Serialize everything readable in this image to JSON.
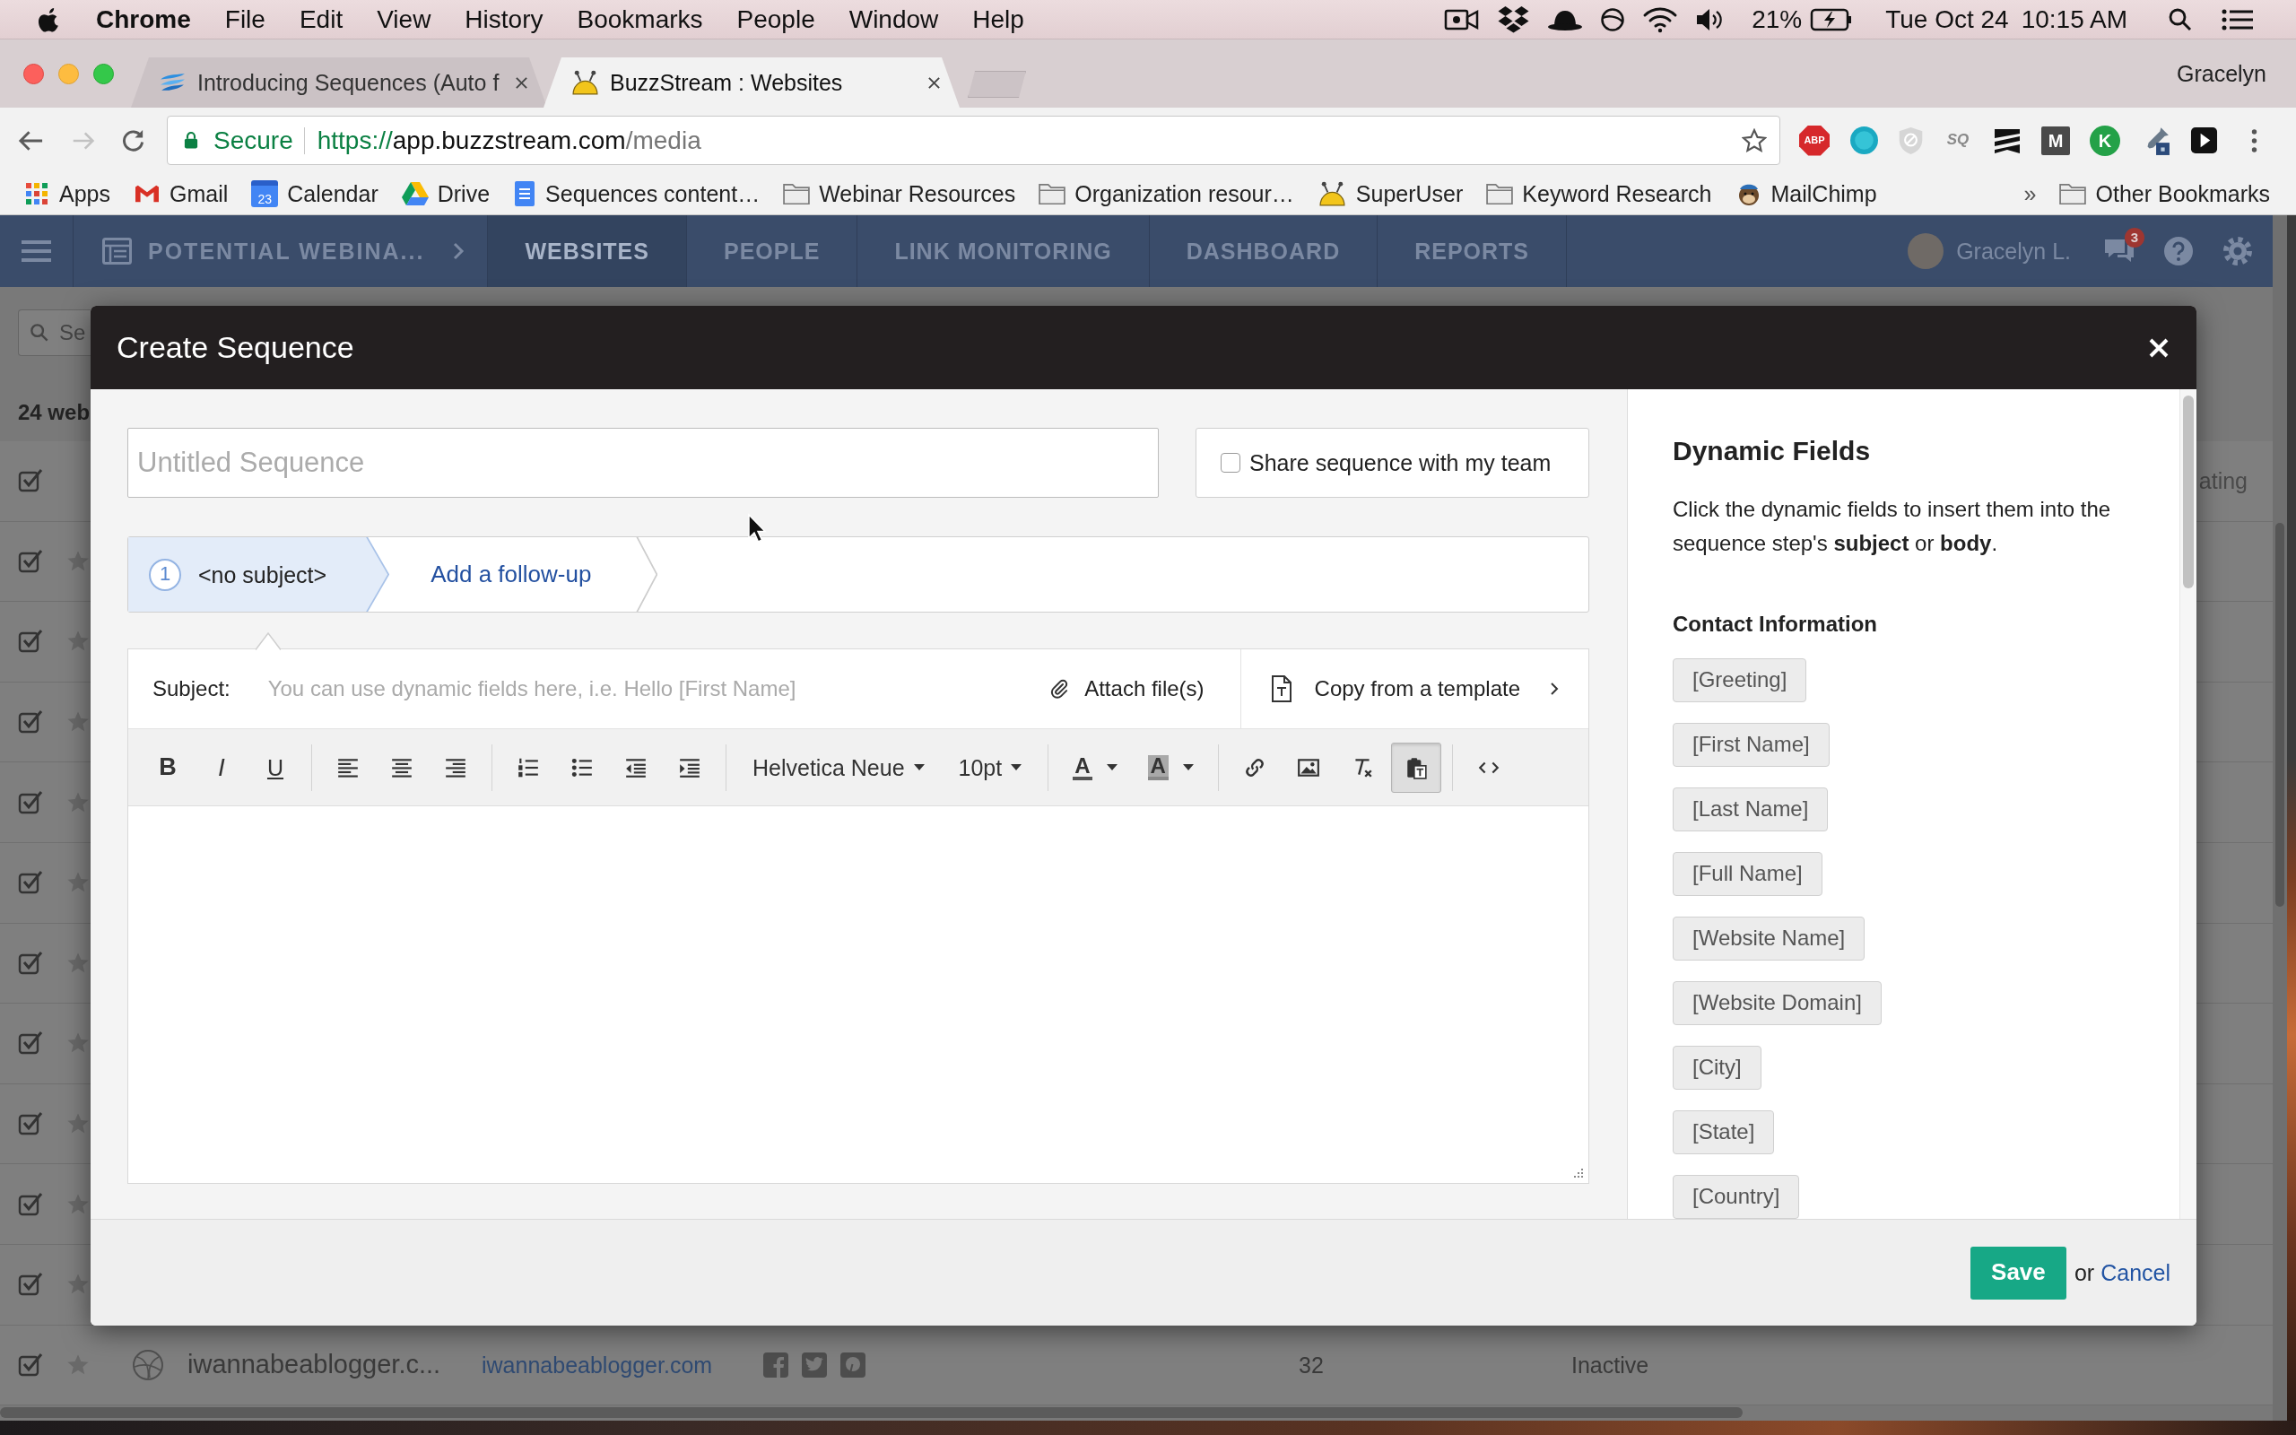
{
  "menu_bar": {
    "app": "Chrome",
    "menus": [
      "File",
      "Edit",
      "View",
      "History",
      "Bookmarks",
      "People",
      "Window",
      "Help"
    ],
    "battery": "21%",
    "date": "Tue Oct 24",
    "time": "10:15 AM"
  },
  "browser": {
    "tabs": [
      {
        "title": "Introducing Sequences (Auto f",
        "selected": false
      },
      {
        "title": "BuzzStream : Websites",
        "selected": true
      }
    ],
    "profile": "Gracelyn",
    "forward_disabled": true,
    "address": {
      "security": "Secure",
      "scheme": "https://",
      "host": "app.buzzstream.com",
      "path": "/media"
    },
    "extensions": [
      {
        "kind": "octagon",
        "text": "ABP"
      },
      {
        "kind": "disc"
      },
      {
        "kind": "shield"
      },
      {
        "kind": "burst",
        "text": "SQ"
      },
      {
        "kind": "stripes"
      },
      {
        "kind": "tile",
        "text": "M"
      },
      {
        "kind": "round",
        "text": "K"
      },
      {
        "kind": "dropper"
      },
      {
        "kind": "play"
      }
    ],
    "bookmarks": [
      {
        "kind": "apps",
        "label": "Apps"
      },
      {
        "kind": "mail",
        "label": "Gmail"
      },
      {
        "kind": "calendar",
        "label": "Calendar",
        "badge": "23"
      },
      {
        "kind": "drive",
        "label": "Drive"
      },
      {
        "kind": "doc",
        "label": "Sequences content…"
      },
      {
        "kind": "folder",
        "label": "Webinar Resources"
      },
      {
        "kind": "folder",
        "label": "Organization resour…"
      },
      {
        "kind": "dome",
        "label": "SuperUser"
      },
      {
        "kind": "folder",
        "label": "Keyword Research"
      },
      {
        "kind": "monkey",
        "label": "MailChimp"
      }
    ],
    "overflow": "»",
    "other_bookmarks": "Other Bookmarks"
  },
  "app": {
    "nav": {
      "project": "POTENTIAL WEBINA...",
      "tabs": [
        {
          "label": "WEBSITES",
          "selected": true
        },
        {
          "label": "PEOPLE",
          "selected": false
        },
        {
          "label": "LINK MONITORING",
          "selected": false
        },
        {
          "label": "DASHBOARD",
          "selected": false
        },
        {
          "label": "REPORTS",
          "selected": false
        }
      ],
      "user": "Gracelyn L.",
      "notifications": "3"
    },
    "search_placeholder": "Se",
    "count": "24 web",
    "rows": [
      {
        "kind": "header",
        "checked": true,
        "column": "ating"
      },
      {
        "kind": "item",
        "checked": true
      },
      {
        "kind": "item",
        "checked": true
      },
      {
        "kind": "item",
        "checked": true
      },
      {
        "kind": "item",
        "checked": true
      },
      {
        "kind": "item",
        "checked": true
      },
      {
        "kind": "item",
        "checked": true
      },
      {
        "kind": "item",
        "checked": true
      },
      {
        "kind": "item",
        "checked": true
      },
      {
        "kind": "item",
        "checked": true
      },
      {
        "kind": "item",
        "checked": true
      },
      {
        "kind": "item",
        "checked": true,
        "name": "iwannabeablogger.c...",
        "domain": "iwannabeablogger.com",
        "count": "32",
        "status": "Inactive"
      }
    ]
  },
  "modal": {
    "title": "Create Sequence",
    "name_placeholder": "Untitled Sequence",
    "share": {
      "label": "Share sequence with my team",
      "checked": false
    },
    "steps": [
      {
        "kind": "step",
        "number": "1",
        "label": "<no subject>",
        "selected": true
      },
      {
        "kind": "add",
        "label": "Add a follow-up",
        "selected": false
      }
    ],
    "subject": {
      "label": "Subject:",
      "placeholder": "You can use dynamic fields here, i.e. Hello [First Name]"
    },
    "attach": "Attach file(s)",
    "template": "Copy from a template",
    "toolbar": [
      [
        {
          "kind": "bold",
          "text": "B",
          "pressed": false
        },
        {
          "kind": "italic",
          "text": "I",
          "pressed": false
        },
        {
          "kind": "underline",
          "text": "U",
          "pressed": false
        }
      ],
      [
        {
          "kind": "alignleft",
          "pressed": false
        },
        {
          "kind": "aligncenter",
          "pressed": false
        },
        {
          "kind": "alignright",
          "pressed": false
        }
      ],
      [
        {
          "kind": "numbered",
          "pressed": false
        },
        {
          "kind": "bulleted",
          "pressed": false
        },
        {
          "kind": "outdent",
          "pressed": false
        },
        {
          "kind": "indent",
          "pressed": false
        }
      ],
      [
        {
          "kind": "dropdown",
          "text": "Helvetica Neue",
          "pressed": false
        },
        {
          "kind": "dropdown",
          "text": "10pt",
          "pressed": false
        }
      ],
      [
        {
          "kind": "forecolor",
          "text": "A",
          "pressed": false
        },
        {
          "kind": "backcolor",
          "text": "A",
          "pressed": false
        }
      ],
      [
        {
          "kind": "link",
          "pressed": false
        },
        {
          "kind": "image",
          "pressed": false
        },
        {
          "kind": "clear",
          "pressed": false
        },
        {
          "kind": "paste",
          "pressed": true
        }
      ],
      [
        {
          "kind": "source",
          "pressed": false
        }
      ]
    ],
    "dynamic_fields": {
      "title": "Dynamic Fields",
      "description": "Click the dynamic fields to insert them into the sequence step's **subject** or **body**.",
      "sections": [
        {
          "title": "Contact Information",
          "fields": [
            "[Greeting]",
            "[First Name]",
            "[Last Name]",
            "[Full Name]",
            "[Website Name]",
            "[Website Domain]",
            "[City]",
            "[State]",
            "[Country]"
          ]
        }
      ]
    },
    "footer": {
      "save": "Save",
      "or": "or",
      "cancel": "Cancel"
    }
  }
}
